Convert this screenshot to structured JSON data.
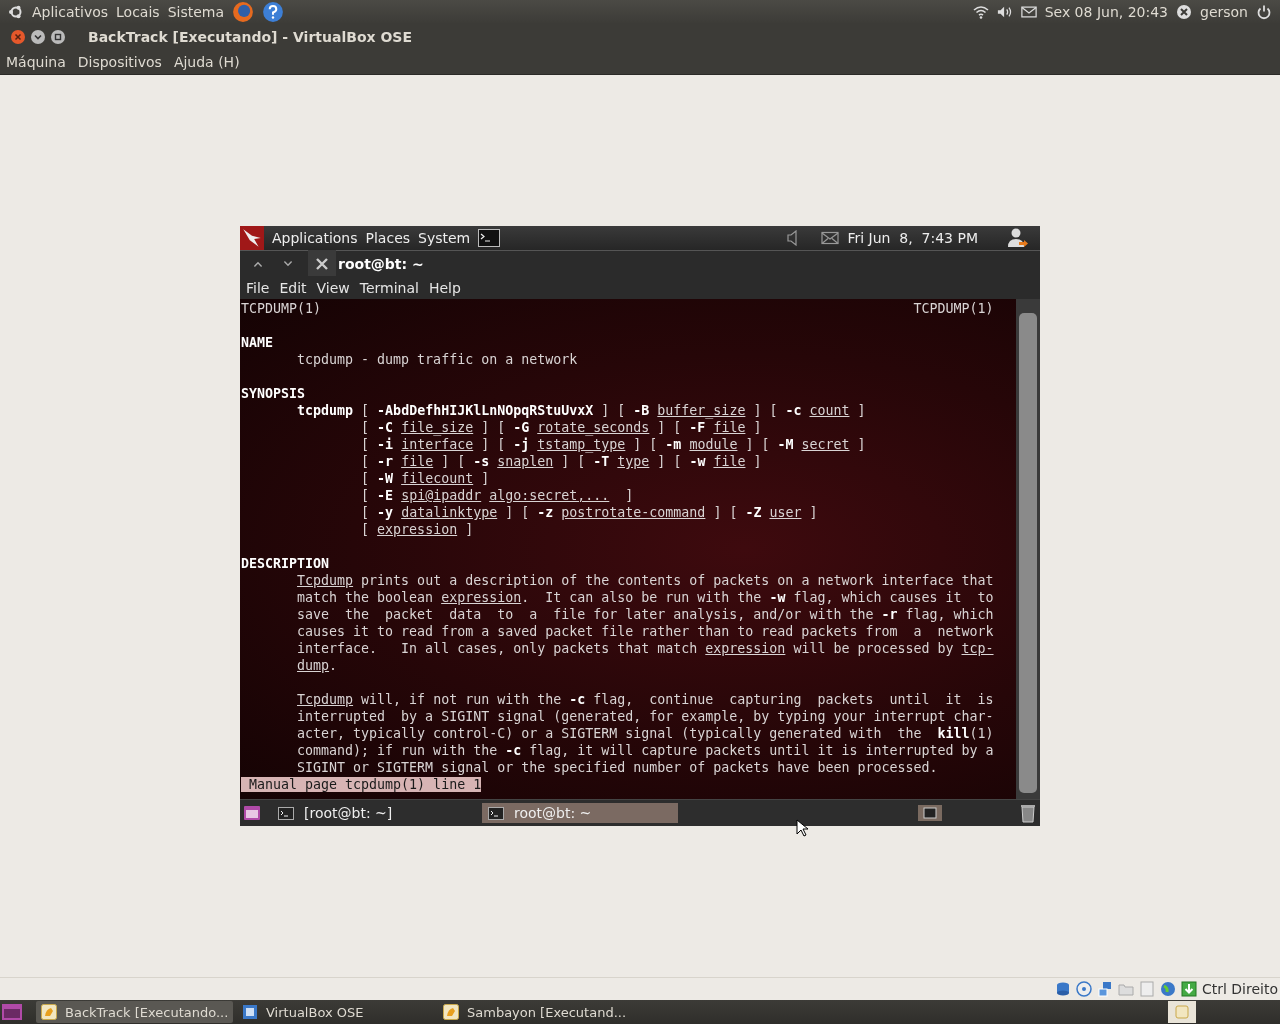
{
  "host_panel": {
    "menus": [
      "Aplicativos",
      "Locais",
      "Sistema"
    ],
    "datetime": "Sex 08 Jun, 20:43",
    "user": "gerson"
  },
  "vm_window": {
    "title": "BackTrack [Executando] - VirtualBox OSE",
    "menu": [
      "Máquina",
      "Dispositivos",
      "Ajuda (H)"
    ]
  },
  "guest_panel": {
    "menus": [
      "Applications",
      "Places",
      "System"
    ],
    "clock": "Fri Jun  8,  7:43 PM"
  },
  "terminal": {
    "title": "root@bt: ~",
    "menu": [
      "File",
      "Edit",
      "View",
      "Terminal",
      "Help"
    ],
    "header_left": "TCPDUMP(1)",
    "header_right": "TCPDUMP(1)",
    "sections": [
      {
        "heading": "NAME",
        "paragraphs": [
          [
            "tcpdump - dump traffic on a network"
          ]
        ]
      },
      {
        "heading": "SYNOPSIS",
        "synopsis": {
          "first": "**tcpdump** [ **-AbdDefhHIJKlLnNOpqRStuUvxX** ] [ **-B** *buffer_size* ] [ **-c** *count* ]",
          "continued": [
            "[ **-C** *file_size* ] [ **-G** *rotate_seconds* ] [ **-F** *file* ]",
            "[ **-i** *interface* ] [ **-j** *tstamp_type* ] [ **-m** *module* ] [ **-M** *secret* ]",
            "[ **-r** *file* ] [ **-s** *snaplen* ] [ **-T** *type* ] [ **-w** *file* ]",
            "[ **-W** *filecount* ]",
            "[ **-E** *spi@ipaddr* *algo:secret,...*  ]",
            "[ **-y** *datalinktype* ] [ **-z** *postrotate-command* ] [ **-Z** *user* ]",
            "[ *expression* ]"
          ]
        }
      },
      {
        "heading": "DESCRIPTION",
        "paragraphs": [
          [
            "*Tcpdump* prints out a description of the contents of packets on a network interface that",
            "match the boolean *expression*.  It can also be run with the **-w** flag, which causes it  to",
            "save  the  packet  data  to  a  file for later analysis, and/or with the **-r** flag, which",
            "causes it to read from a saved packet file rather than to read packets from  a  network",
            "interface.   In all cases, only packets that match *expression* will be processed by *tcp-*",
            "*dump*."
          ],
          [
            "*Tcpdump* will, if not run with the **-c** flag,  continue  capturing  packets  until  it  is",
            "interrupted  by a SIGINT signal (generated, for example, by typing your interrupt char-",
            "acter, typically control-C) or a SIGTERM signal (typically generated with  the  **kill**(1)",
            "command); if run with the **-c** flag, it will capture packets until it is interrupted by a",
            "SIGINT or SIGTERM signal or the specified number of packets have been processed."
          ]
        ]
      }
    ],
    "status": "Manual page tcpdump(1) line 1"
  },
  "guest_taskbar": [
    {
      "label": "[root@bt: ~]",
      "selected": false
    },
    {
      "label": "root@bt: ~",
      "selected": true
    }
  ],
  "vm_status": {
    "host_key": "Ctrl Direito"
  },
  "host_taskbar": [
    {
      "kind": "vm",
      "label": "BackTrack [Executando...",
      "selected": true
    },
    {
      "kind": "manager",
      "label": "VirtualBox OSE",
      "selected": false
    },
    {
      "kind": "vm",
      "label": "Sambayon [Executand...",
      "selected": false
    }
  ]
}
